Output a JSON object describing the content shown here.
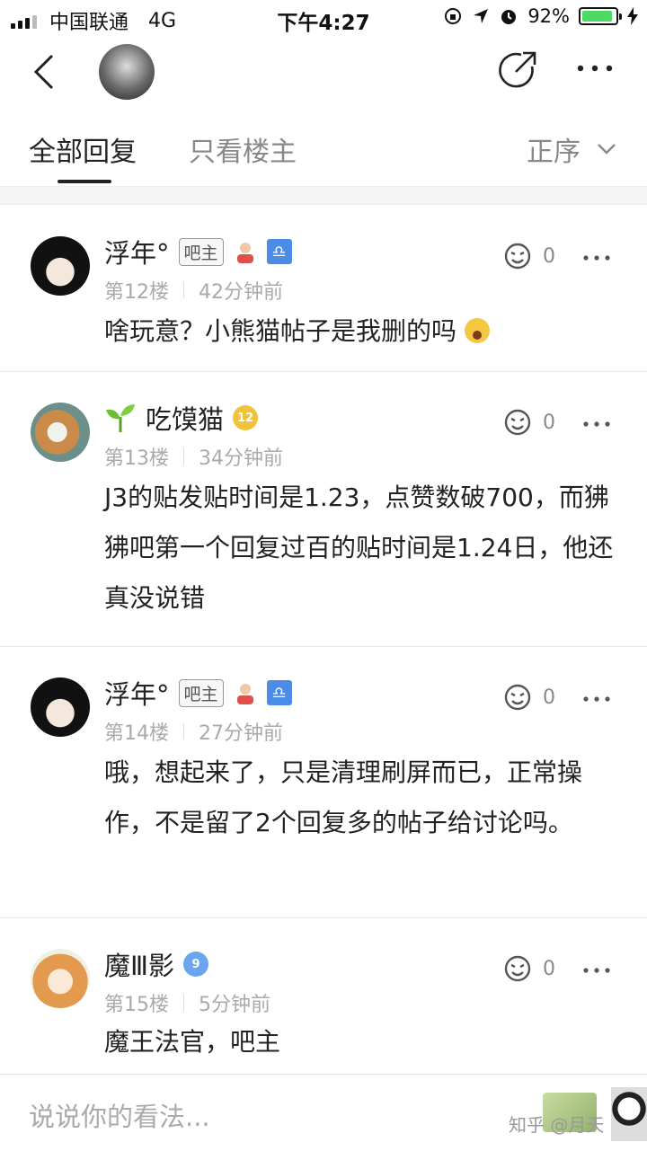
{
  "status_bar": {
    "carrier": "中国联通",
    "network": "4G",
    "time": "下午4:27",
    "battery_percent": "92%",
    "battery_level": 0.92
  },
  "header": {
    "back_icon": "chevron-left-icon",
    "share_icon": "share-icon",
    "more_icon": "more-horizontal-icon"
  },
  "tabs": {
    "all": "全部回复",
    "owner_only": "只看楼主",
    "sort": "正序"
  },
  "posts": [
    {
      "username": "浮年°",
      "owner_badge": "吧主",
      "floor": "第12楼",
      "time": "42分钟前",
      "likes": "0",
      "content": "啥玩意？小熊猫帖子是我删的吗"
    },
    {
      "username": "吃馍猫",
      "level": "12",
      "floor": "第13楼",
      "time": "34分钟前",
      "likes": "0",
      "content": "J3的贴发贴时间是1.23，点赞数破700，而狒狒吧第一个回复过百的贴时间是1.24日，他还真没说错"
    },
    {
      "username": "浮年°",
      "owner_badge": "吧主",
      "floor": "第14楼",
      "time": "27分钟前",
      "likes": "0",
      "content": "哦，想起来了，只是清理刷屏而已，正常操作，不是留了2个回复多的帖子给讨论吗。"
    },
    {
      "username": "魔Ⅲ影",
      "level": "9",
      "floor": "第15楼",
      "time": "5分钟前",
      "likes": "0",
      "content": "魔王法官，吧主"
    }
  ],
  "bottom_bar": {
    "placeholder": "说说你的看法...",
    "watermark": "知乎 @月天"
  },
  "colors": {
    "battery_green": "#4cd964",
    "libra_blue": "#4a8ce8",
    "level_gold": "#f2c33a",
    "level_blue": "#6aa5ee"
  }
}
